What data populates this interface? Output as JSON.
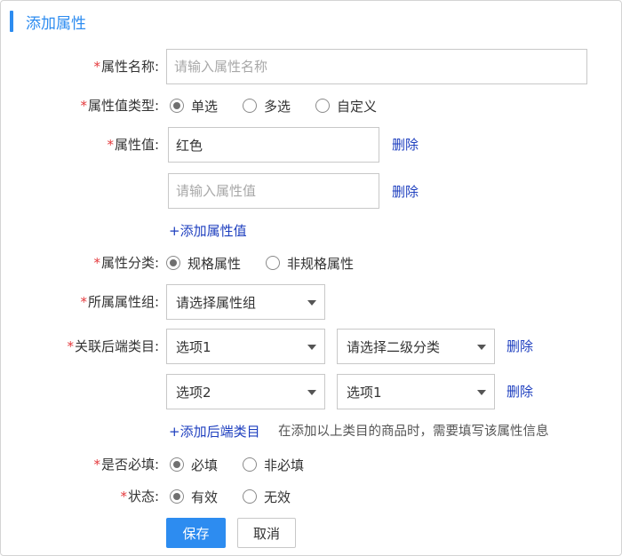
{
  "header": {
    "title": "添加属性"
  },
  "form": {
    "name": {
      "label": "属性名称:",
      "placeholder": "请输入属性名称",
      "value": ""
    },
    "value_type": {
      "label": "属性值类型:",
      "options": [
        "单选",
        "多选",
        "自定义"
      ],
      "selected": "单选"
    },
    "values": {
      "label": "属性值:",
      "items": [
        {
          "value": "红色",
          "placeholder": "请输入属性值",
          "delete": "删除"
        },
        {
          "value": "",
          "placeholder": "请输入属性值",
          "delete": "删除"
        }
      ],
      "add_link": "+添加属性值"
    },
    "category_kind": {
      "label": "属性分类:",
      "options": [
        "规格属性",
        "非规格属性"
      ],
      "selected": "规格属性"
    },
    "group": {
      "label": "所属属性组:",
      "value": "请选择属性组"
    },
    "backend_category": {
      "label": "关联后端类目:",
      "rows": [
        {
          "level1": "选项1",
          "level2": "请选择二级分类",
          "delete": "删除"
        },
        {
          "level1": "选项2",
          "level2": "选项1",
          "delete": "删除"
        }
      ],
      "add_link": "+添加后端类目",
      "hint": "在添加以上类目的商品时，需要填写该属性信息"
    },
    "required": {
      "label": "是否必填:",
      "options": [
        "必填",
        "非必填"
      ],
      "selected": "必填"
    },
    "status": {
      "label": "状态:",
      "options": [
        "有效",
        "无效"
      ],
      "selected": "有效"
    }
  },
  "actions": {
    "save": "保存",
    "cancel": "取消"
  },
  "colors": {
    "accent": "#2d8cf0",
    "required_mark": "#e4393c",
    "link": "#1e3fbf"
  },
  "icons": {
    "select_caret": "caret-down-icon",
    "radio": "radio-icon"
  }
}
